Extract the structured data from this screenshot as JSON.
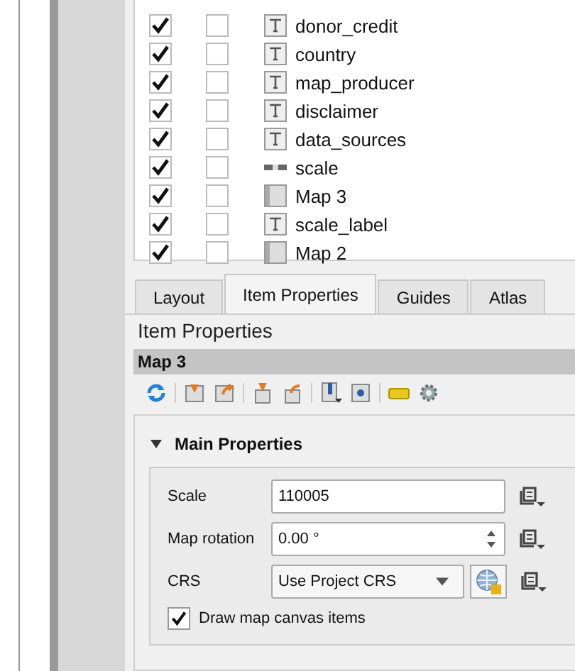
{
  "items": [
    {
      "name": "donor_credit",
      "kind": "text",
      "visible": true,
      "locked": false
    },
    {
      "name": "country",
      "kind": "text",
      "visible": true,
      "locked": false
    },
    {
      "name": "map_producer",
      "kind": "text",
      "visible": true,
      "locked": false
    },
    {
      "name": "disclaimer",
      "kind": "text",
      "visible": true,
      "locked": false
    },
    {
      "name": "data_sources",
      "kind": "text",
      "visible": true,
      "locked": false
    },
    {
      "name": "scale",
      "kind": "scalebar",
      "visible": true,
      "locked": false
    },
    {
      "name": "Map 3",
      "kind": "map",
      "visible": true,
      "locked": false
    },
    {
      "name": "scale_label",
      "kind": "text",
      "visible": true,
      "locked": false
    },
    {
      "name": "Map 2",
      "kind": "map",
      "visible": true,
      "locked": false
    }
  ],
  "tabs": [
    {
      "label": "Layout",
      "selected": false
    },
    {
      "label": "Item Properties",
      "selected": true
    },
    {
      "label": "Guides",
      "selected": false
    },
    {
      "label": "Atlas",
      "selected": false
    }
  ],
  "panel_title": "Item Properties",
  "item_title": "Map 3",
  "group": {
    "title": "Main Properties",
    "expanded": true,
    "scale": {
      "label": "Scale",
      "value": "110005"
    },
    "rotation": {
      "label": "Map rotation",
      "value": "0.00 °"
    },
    "crs": {
      "label": "CRS",
      "value": "Use Project CRS"
    },
    "draw_canvas_items": {
      "label": "Draw map canvas items",
      "checked": true
    }
  }
}
